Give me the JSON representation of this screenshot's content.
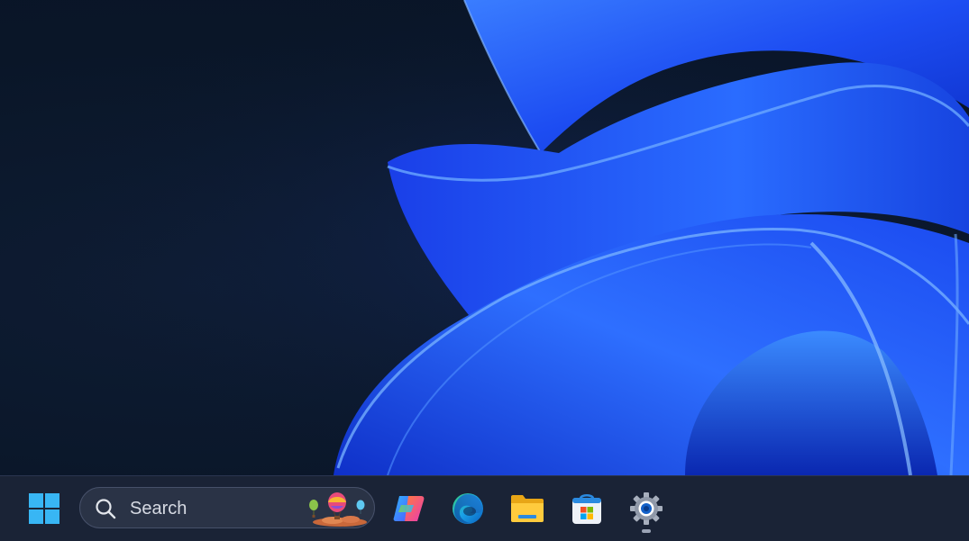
{
  "taskbar": {
    "search": {
      "label": "Search"
    },
    "apps": [
      {
        "name": "copilot",
        "icon": "copilot-icon"
      },
      {
        "name": "edge",
        "icon": "edge-icon"
      },
      {
        "name": "file-explorer",
        "icon": "folder-icon"
      },
      {
        "name": "microsoft-store",
        "icon": "store-icon"
      },
      {
        "name": "settings",
        "icon": "gear-icon",
        "running": true
      }
    ]
  },
  "colors": {
    "taskbar_bg": "#1a2336",
    "wallpaper_dark": "#0a1628",
    "bloom_blue": "#1f4bff",
    "windows_logo": "#38b6f4"
  }
}
